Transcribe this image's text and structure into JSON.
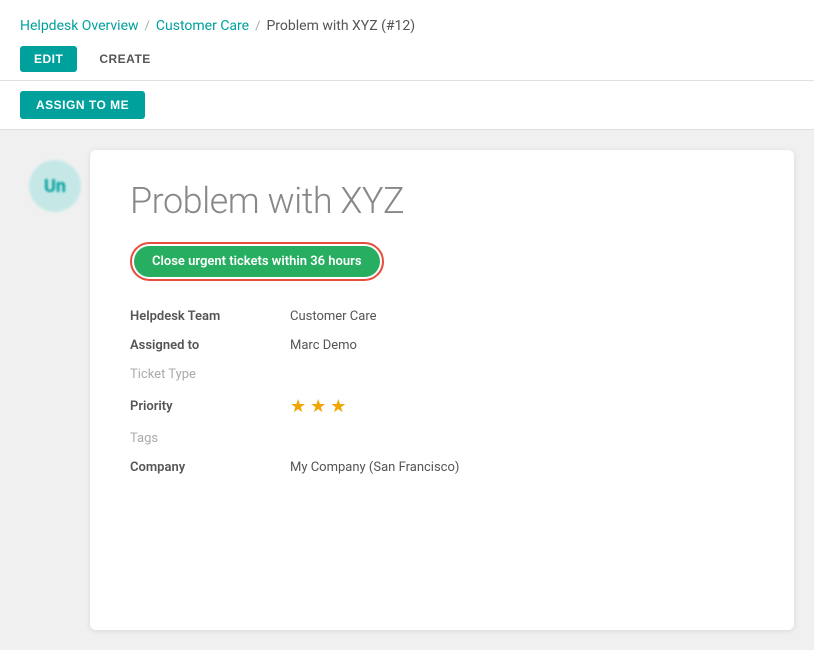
{
  "breadcrumb": {
    "items": [
      {
        "label": "Helpdesk Overview",
        "id": "helpdesk-overview"
      },
      {
        "label": "Customer Care",
        "id": "customer-care"
      },
      {
        "label": "Problem with XYZ (#12)",
        "id": "ticket-title"
      }
    ],
    "separators": [
      "/",
      "/"
    ]
  },
  "toolbar": {
    "edit_label": "EDIT",
    "create_label": "CREATE"
  },
  "action_bar": {
    "assign_label": "ASSIGN TO ME"
  },
  "avatar": {
    "initials": "Un"
  },
  "card": {
    "title": "Problem with XYZ",
    "sla_badge": "Close urgent tickets within 36 hours",
    "fields": [
      {
        "label": "Helpdesk Team",
        "value": "Customer Care",
        "label_style": "bold"
      },
      {
        "label": "Assigned to",
        "value": "Marc Demo",
        "label_style": "bold"
      },
      {
        "label": "Ticket Type",
        "value": "",
        "label_style": "light"
      },
      {
        "label": "Priority",
        "value": "stars",
        "label_style": "bold",
        "stars": 3,
        "max_stars": 3
      },
      {
        "label": "Tags",
        "value": "",
        "label_style": "light"
      },
      {
        "label": "Company",
        "value": "My Company (San Francisco)",
        "label_style": "bold"
      }
    ]
  }
}
